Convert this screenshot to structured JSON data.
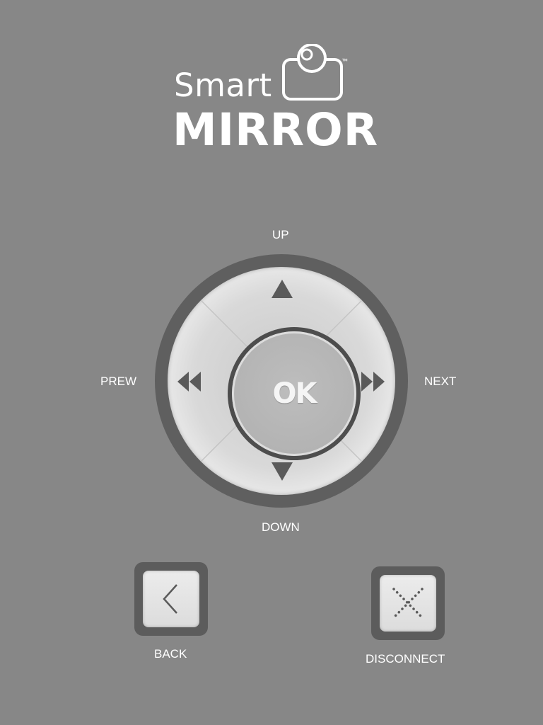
{
  "logo": {
    "smart": "Smart",
    "mirror": "MIRROR",
    "tm": "™",
    "icon": "camera-icon"
  },
  "dpad": {
    "up_label": "UP",
    "down_label": "DOWN",
    "prev_label": "PREW",
    "next_label": "NEXT",
    "ok_label": "OK",
    "icons": {
      "up": "triangle-up-icon",
      "down": "triangle-down-icon",
      "prev": "rewind-icon",
      "next": "fast-forward-icon"
    }
  },
  "buttons": {
    "back_label": "BACK",
    "back_icon": "chevron-left-icon",
    "disconnect_label": "DISCONNECT",
    "disconnect_icon": "dotted-x-icon"
  },
  "colors": {
    "background": "#878787",
    "ring": "#5f5f5f",
    "pad": "#e6e6e6",
    "icon": "#5a5a5a",
    "text": "#ffffff"
  }
}
